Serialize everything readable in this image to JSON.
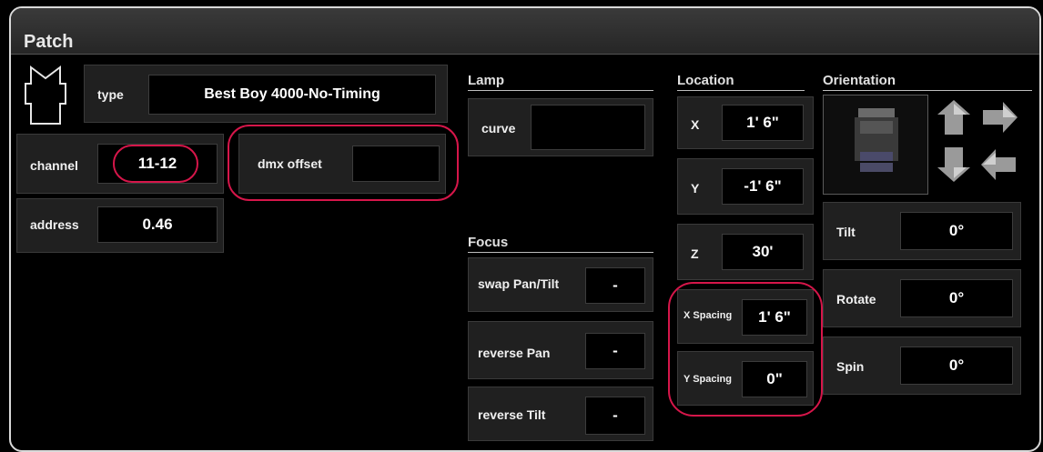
{
  "window": {
    "title": "Patch"
  },
  "patch": {
    "type_label": "type",
    "type_value": "Best Boy 4000-No-Timing",
    "channel_label": "channel",
    "channel_value": "11-12",
    "dmx_offset_label": "dmx offset",
    "dmx_offset_value": "",
    "address_label": "address",
    "address_value": "0.46"
  },
  "lamp": {
    "heading": "Lamp",
    "curve_label": "curve",
    "curve_value": ""
  },
  "focus": {
    "heading": "Focus",
    "swap_label": "swap Pan/Tilt",
    "swap_value": "-",
    "reverse_pan_label": "reverse Pan",
    "reverse_pan_value": "-",
    "reverse_tilt_label": "reverse Tilt",
    "reverse_tilt_value": "-"
  },
  "location": {
    "heading": "Location",
    "x_label": "X",
    "x_value": "1' 6\"",
    "y_label": "Y",
    "y_value": "-1' 6\"",
    "z_label": "Z",
    "z_value": "30'",
    "x_spacing_label": "X Spacing",
    "x_spacing_value": "1' 6\"",
    "y_spacing_label": "Y Spacing",
    "y_spacing_value": "0\""
  },
  "orientation": {
    "heading": "Orientation",
    "tilt_label": "Tilt",
    "tilt_value": "0°",
    "rotate_label": "Rotate",
    "rotate_value": "0°",
    "spin_label": "Spin",
    "spin_value": "0°"
  },
  "icons": [
    "fixture-outline-icon",
    "fixture-preview-icon",
    "rotate-up-icon",
    "rotate-right-icon",
    "rotate-down-icon",
    "rotate-left-icon"
  ],
  "colors": {
    "highlight": "#d6164a",
    "panel": "#202020",
    "field": "#000000"
  }
}
